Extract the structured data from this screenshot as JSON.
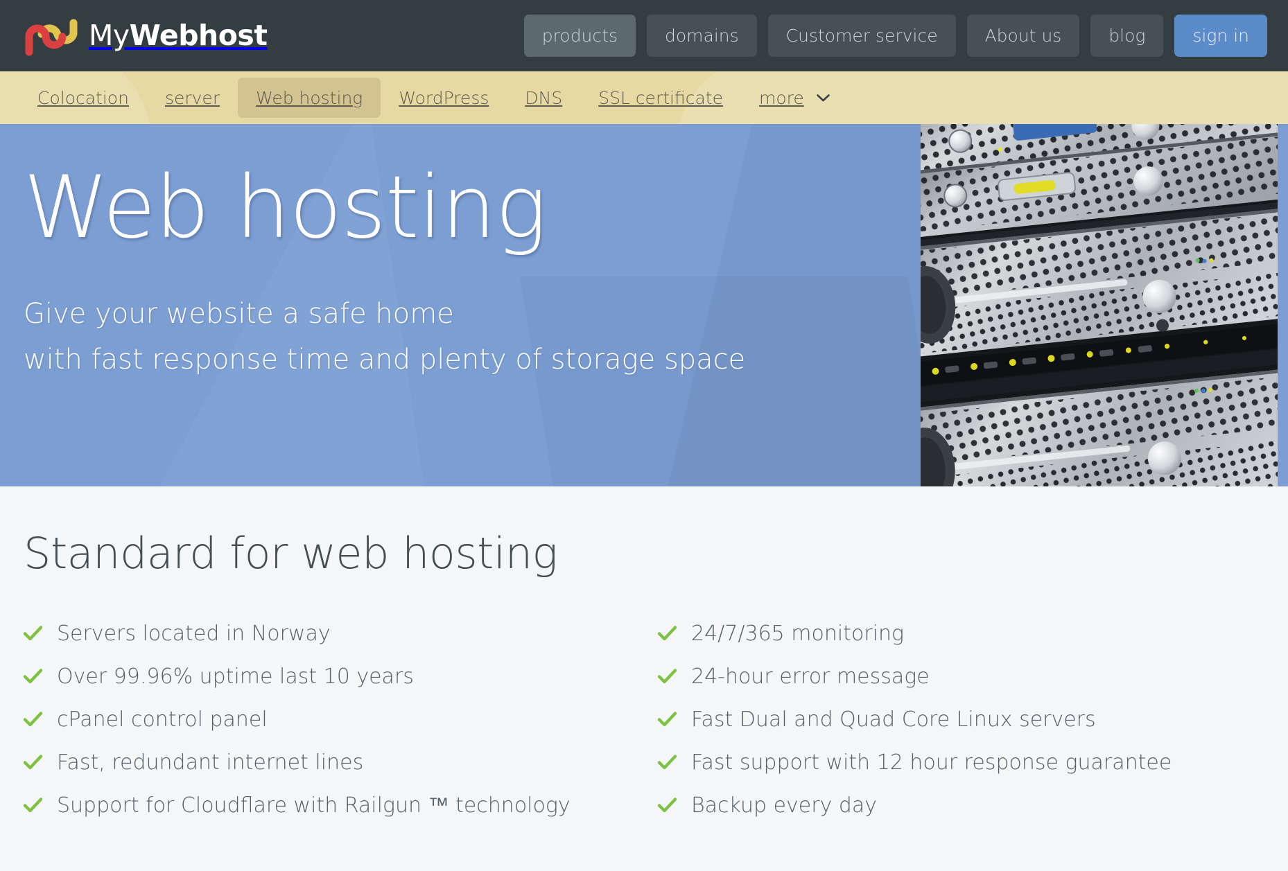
{
  "header": {
    "brand_prefix": "My",
    "brand_suffix": "Webhost",
    "logo_icon": "intertwined-n-u-logo",
    "logo_colors": {
      "red": "#d9403f",
      "yellow": "#e0c44e"
    },
    "nav": [
      {
        "label": "products",
        "state": "hover"
      },
      {
        "label": "domains",
        "state": "default"
      },
      {
        "label": "Customer service",
        "state": "default"
      },
      {
        "label": "About us",
        "state": "default"
      },
      {
        "label": "blog",
        "state": "default"
      },
      {
        "label": "sign in",
        "state": "primary"
      }
    ],
    "bar_color": "#333d42",
    "primary_button_color": "#5b8bc9"
  },
  "subnav": {
    "bar_color": "#e6d9a3",
    "active_color": "#d2c391",
    "items": [
      {
        "label": "Colocation",
        "active": false,
        "chevron": false
      },
      {
        "label": "server",
        "active": false,
        "chevron": false
      },
      {
        "label": "Web hosting",
        "active": true,
        "chevron": false
      },
      {
        "label": "WordPress",
        "active": false,
        "chevron": false
      },
      {
        "label": "DNS",
        "active": false,
        "chevron": false
      },
      {
        "label": "SSL certificate",
        "active": false,
        "chevron": false
      },
      {
        "label": "more",
        "active": false,
        "chevron": true
      }
    ]
  },
  "hero": {
    "title": "Web hosting",
    "subtitle_line1": "Give your website a safe home",
    "subtitle_line2": "with fast response time and plenty of storage space",
    "background_color": "#7c9ed3",
    "image_alt": "server-rack-photo"
  },
  "main": {
    "section_title": "Standard for web hosting",
    "check_color": "#7dc242",
    "features_left": [
      "Servers located in Norway",
      "Over 99.96% uptime last 10 years",
      "cPanel control panel",
      "Fast, redundant internet lines",
      "Support for Cloudflare with Railgun ™ technology"
    ],
    "features_right": [
      "24/7/365 monitoring",
      "24-hour error message",
      "Fast Dual and Quad Core Linux servers",
      "Fast support with 12 hour response guarantee",
      "Backup every day"
    ]
  }
}
